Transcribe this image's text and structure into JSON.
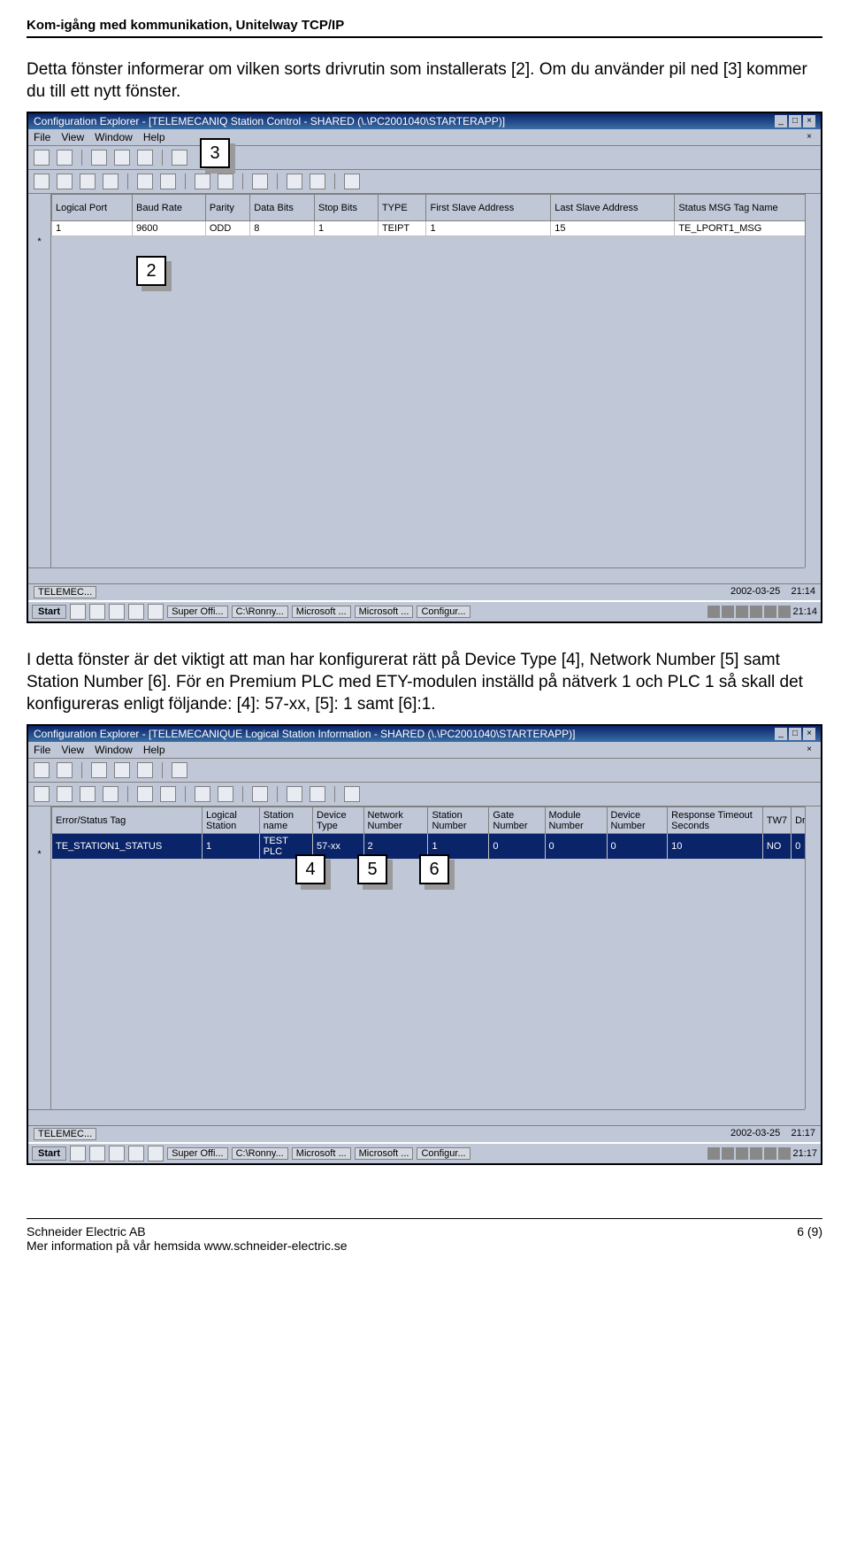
{
  "header": {
    "title": "Kom-igång med kommunikation, Unitelway TCP/IP"
  },
  "para1": "Detta fönster informerar om vilken sorts drivrutin som installerats [2]. Om du använder pil ned [3] kommer du till ett nytt fönster.",
  "para2": "I detta fönster är det viktigt att man har konfigurerat rätt på Device Type [4], Network Number [5] samt Station Number [6]. För en Premium PLC med ETY-modulen inställd på nätverk 1 och PLC 1 så skall det konfigureras enligt följande: [4]: 57-xx, [5]: 1 samt [6]:1.",
  "screenshot1": {
    "title": "Configuration Explorer - [TELEMECANIQ       Station Control - SHARED (\\.\\PC2001040\\STARTERAPP)]",
    "menu": {
      "file": "File",
      "view": "View",
      "window": "Window",
      "help": "Help"
    },
    "columns": [
      "Logical Port",
      "Baud Rate",
      "Parity",
      "Data Bits",
      "Stop Bits",
      "TYPE",
      "First Slave Address",
      "Last Slave Address",
      "Status MSG Tag Name"
    ],
    "row": [
      "1",
      "9600",
      "ODD",
      "8",
      "1",
      "TEIPT",
      "1",
      "15",
      "TE_LPORT1_MSG"
    ],
    "callouts": {
      "c3": "3",
      "c2": "2"
    },
    "task_app": "TELEMEC...",
    "status": {
      "date": "2002-03-25",
      "time": "21:14"
    },
    "taskbar": {
      "start": "Start",
      "apps": [
        "Super Offi...",
        "C:\\Ronny...",
        "Microsoft ...",
        "Microsoft ...",
        "Configur..."
      ],
      "time": "21:14"
    }
  },
  "screenshot2": {
    "title": "Configuration Explorer - [TELEMECANIQUE Logical Station Information - SHARED (\\.\\PC2001040\\STARTERAPP)]",
    "menu": {
      "file": "File",
      "view": "View",
      "window": "Window",
      "help": "Help"
    },
    "columns": [
      "Error/Status Tag",
      "Logical Station",
      "Station name",
      "Device Type",
      "Network Number",
      "Station Number",
      "Gate Number",
      "Module Number",
      "Device Number",
      "Response Timeout Seconds",
      "TW7",
      "Drop"
    ],
    "row": [
      "TE_STATION1_STATUS",
      "1",
      "TEST PLC",
      "57-xx",
      "2",
      "1",
      "0",
      "0",
      "0",
      "10",
      "NO",
      "0"
    ],
    "callouts": {
      "c4": "4",
      "c5": "5",
      "c6": "6"
    },
    "task_app": "TELEMEC...",
    "status": {
      "date": "2002-03-25",
      "time": "21:17"
    },
    "taskbar": {
      "start": "Start",
      "apps": [
        "Super Offi...",
        "C:\\Ronny...",
        "Microsoft ...",
        "Microsoft ...",
        "Configur..."
      ],
      "time": "21:17"
    }
  },
  "footer": {
    "company": "Schneider Electric AB",
    "tagline": "Mer information på vår hemsida www.schneider-electric.se",
    "page": "6 (9)"
  }
}
